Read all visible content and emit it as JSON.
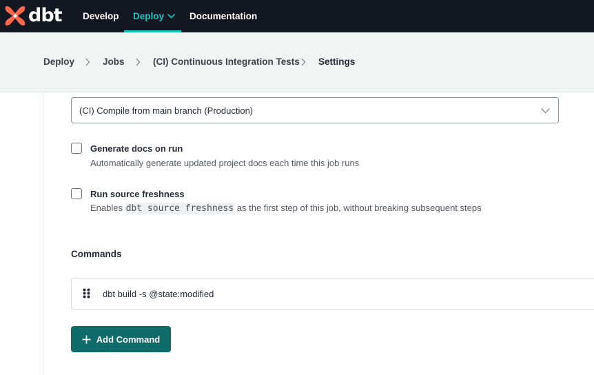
{
  "brand": {
    "name": "dbt",
    "accent": "#16c4c0",
    "logo_color": "#ff694a"
  },
  "nav": {
    "items": [
      {
        "label": "Develop"
      },
      {
        "label": "Deploy",
        "active": true
      },
      {
        "label": "Documentation"
      }
    ]
  },
  "breadcrumb": {
    "items": [
      {
        "label": "Deploy"
      },
      {
        "label": "Jobs"
      },
      {
        "label": "(CI) Continuous Integration Tests"
      },
      {
        "label": "Settings"
      }
    ]
  },
  "form": {
    "compare_select": {
      "value": "(CI) Compile from main branch (Production)"
    },
    "generate_docs": {
      "title": "Generate docs on run",
      "description": "Automatically generate updated project docs each time this job runs",
      "checked": false
    },
    "source_freshness": {
      "title": "Run source freshness",
      "description_prefix": "Enables",
      "code": "dbt source freshness",
      "description_suffix": "as the first step of this job, without breaking subsequent steps",
      "checked": false
    },
    "commands": {
      "title": "Commands",
      "items": [
        {
          "command": "dbt build -s @state:modified"
        }
      ],
      "add_label": "Add Command"
    }
  }
}
